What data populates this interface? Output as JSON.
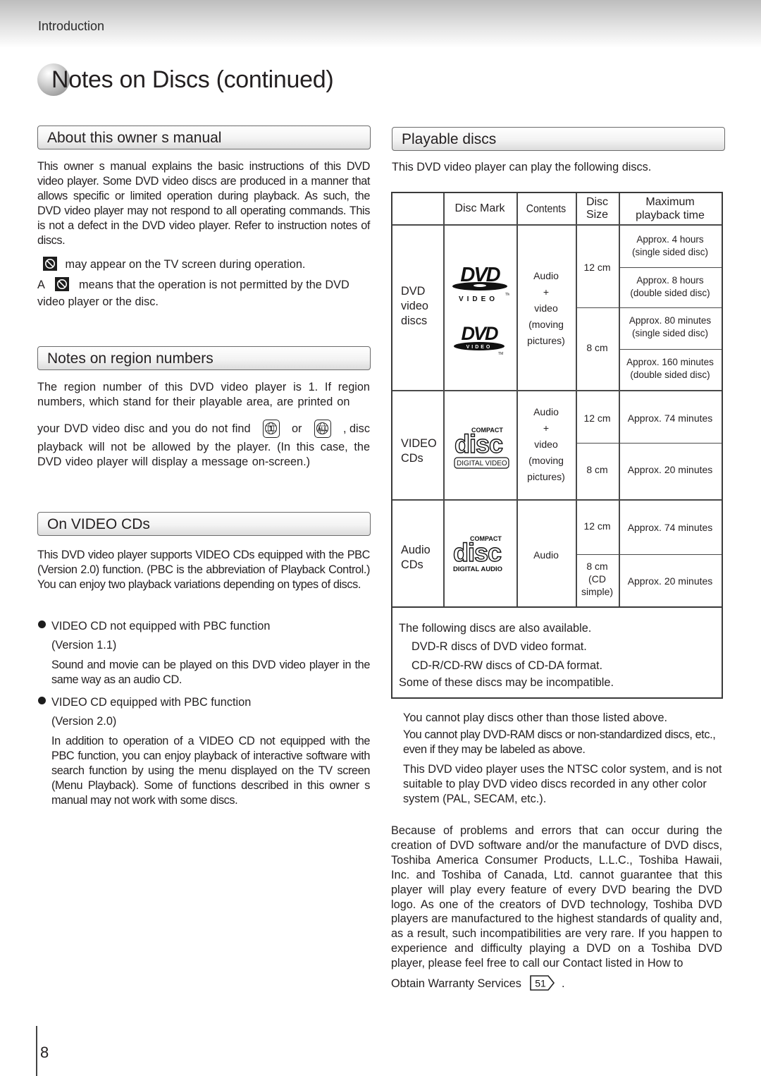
{
  "header": {
    "section": "Introduction",
    "title": "Notes on Discs (continued)"
  },
  "left": {
    "about": {
      "heading": "About this owner s manual",
      "body": "This owner s manual explains the basic instructions of this DVD video player. Some DVD video discs are produced in a manner that allows specific or limited operation during playback. As such, the DVD video player may not respond to all operating commands. This is not a defect in the DVD video player. Refer to instruction notes of discs.",
      "icon_line": "may appear on the TV screen during operation.",
      "means_prefix": "A",
      "means_text_1": "means that the operation is not permitted by the DVD",
      "means_text_2": "video player or the disc.",
      "icon": "prohibited-icon"
    },
    "region": {
      "heading": "Notes on region numbers",
      "body_1": "The region number of this DVD video player is 1. If region numbers, which stand for their playable area, are printed on",
      "body_2a": "your DVD video disc and you do not find",
      "icon_1_label": "1",
      "or": "or",
      "icon_2_label": "ALL",
      "body_2b": ", disc",
      "body_3": "playback will not be allowed by the player. (In this case, the DVD video player will display a message on-screen.)"
    },
    "vcd": {
      "heading": "On VIDEO CDs",
      "body": "This DVD video player supports VIDEO CDs equipped with the PBC (Version 2.0) function. (PBC is the abbreviation of Playback Control.) You can enjoy two playback variations depending on types of discs.",
      "items": [
        {
          "title": "VIDEO CD not equipped with PBC function",
          "version": "(Version 1.1)",
          "desc": "Sound and movie can be played on this DVD video player in the same way as an audio CD."
        },
        {
          "title": "VIDEO CD equipped with PBC function",
          "version": "(Version 2.0)",
          "desc": "In addition to operation of a VIDEO CD not equipped with the PBC function, you can enjoy playback of interactive software with search function by using the menu displayed on the TV screen (Menu Playback). Some of functions described in this owner s manual may not work with some discs."
        }
      ]
    }
  },
  "right": {
    "playable": {
      "heading": "Playable discs",
      "intro": "This  DVD video player can play the following discs."
    },
    "table": {
      "headers": [
        "",
        "Disc Mark",
        "Contents",
        "Disc Size",
        "Maximum playback time"
      ],
      "header_size_1": "Disc",
      "header_size_2": "Size",
      "header_max_1": "Maximum",
      "header_max_2": "playback time",
      "rows": [
        {
          "type_lines": [
            "DVD",
            "video",
            "discs"
          ],
          "mark": "DVD VIDEO logo",
          "dvd_logo_text": "DVD",
          "dvd_logo_sub": "VIDEO",
          "tm": "TM",
          "contents_lines": [
            "Audio",
            "+",
            "video",
            "(moving",
            "pictures)"
          ],
          "sizes": [
            {
              "size": "12 cm",
              "times": [
                [
                  "Approx. 4 hours",
                  "(single sided disc)"
                ],
                [
                  "Approx. 8 hours",
                  "(double sided disc)"
                ]
              ]
            },
            {
              "size": "8 cm",
              "times": [
                [
                  "Approx. 80 minutes",
                  "(single sided disc)"
                ],
                [
                  "Approx. 160 minutes",
                  "(double sided disc)"
                ]
              ]
            }
          ]
        },
        {
          "type_lines": [
            "VIDEO",
            "CDs"
          ],
          "mark": "COMPACT disc DIGITAL VIDEO logo",
          "logo_top": "COMPACT",
          "logo_mid": "disc",
          "logo_bottom": "DIGITAL VIDEO",
          "contents_lines": [
            "Audio",
            "+",
            "video",
            "(moving",
            "pictures)"
          ],
          "sizes": [
            {
              "size": "12 cm",
              "time": "Approx. 74 minutes"
            },
            {
              "size": "8 cm",
              "time": "Approx. 20 minutes"
            }
          ]
        },
        {
          "type_lines": [
            "Audio",
            "CDs"
          ],
          "mark": "COMPACT disc DIGITAL AUDIO logo",
          "logo_top": "COMPACT",
          "logo_mid": "disc",
          "logo_bottom": "DIGITAL AUDIO",
          "contents_lines": [
            "Audio"
          ],
          "sizes": [
            {
              "size": "12 cm",
              "time": "Approx. 74 minutes"
            },
            {
              "size_lines": [
                "8 cm",
                "(CD",
                "simple)"
              ],
              "time": "Approx. 20 minutes"
            }
          ]
        }
      ]
    },
    "also": {
      "lines": [
        "The following discs are also available.",
        "DVD-R discs of DVD video format.",
        "CD-R/CD-RW discs of CD-DA format.",
        "Some of these discs may be incompatible."
      ]
    },
    "notes": {
      "n1": "You cannot play discs other than those listed above.",
      "n2": "You cannot play DVD-RAM discs or non-standardized discs, etc., even if they may be labeled as above.",
      "n3": "This DVD video player uses the NTSC color system, and is not suitable to play DVD video discs recorded in any other color system (PAL, SECAM, etc.)."
    },
    "disclaimer": {
      "body": "Because of problems and errors that can occur during the creation of DVD software and/or the manufacture of DVD discs, Toshiba America Consumer Products, L.L.C., Toshiba Hawaii, Inc. and Toshiba of Canada, Ltd. cannot guarantee that this player will play every feature of every DVD bearing the DVD logo. As one of the creators of DVD technology, Toshiba DVD players are manufactured to the highest standards of quality and, as a result, such incompatibilities are very rare. If you happen to experience and difficulty playing a DVD on a Toshiba DVD player, please feel free to call our Contact listed in  How to",
      "last_line": "Obtain Warranty Services",
      "ref_page": "51",
      "end": "."
    }
  },
  "footer": {
    "page_number": "8"
  }
}
